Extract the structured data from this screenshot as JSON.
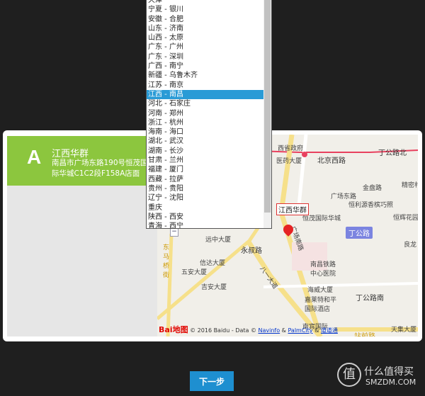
{
  "store": {
    "letter": "A",
    "name": "江西华群",
    "address": "南昌市广场东路190号恒茂国际华城C1C2段F158A店面"
  },
  "city_list": {
    "items": [
      "天津",
      "宁夏 - 银川",
      "安徽 - 合肥",
      "山东 - 济南",
      "山西 - 太原",
      "广东 - 广州",
      "广东 - 深圳",
      "广西 - 南宁",
      "新疆 - 乌鲁木齐",
      "江苏 - 南京",
      "江西 - 南昌",
      "河北 - 石家庄",
      "河南 - 郑州",
      "浙江 - 杭州",
      "海南 - 海口",
      "湖北 - 武汉",
      "湖南 - 长沙",
      "甘肃 - 兰州",
      "福建 - 厦门",
      "西藏 - 拉萨",
      "贵州 - 贵阳",
      "辽宁 - 沈阳",
      "重庆",
      "陕西 - 西安",
      "青海 - 西宁"
    ],
    "selected": "江西 - 南昌"
  },
  "map": {
    "marker_label": "江西华群",
    "labels": [
      "西省政府",
      "医药大厦",
      "北京西路",
      "丁公路北",
      "金盘路",
      "广场东路",
      "恒利源香槟巧照",
      "恒茂国际华城",
      "恒辉花园",
      "精密村",
      "远中大厦",
      "永叔路",
      "信达大厦",
      "五安大厦",
      "吉安大厦",
      "南昌铁路中心医院",
      "海威大厦",
      "嘉莱特和平国际酒店",
      "丁公路南",
      "南宾国际",
      "天集大厦",
      "站前路",
      "广场南路",
      "八一大道",
      "东马桥街",
      "良龙"
    ],
    "badge": "丁公路",
    "zoom_out": "−",
    "copyright": {
      "brand": "Bai地图",
      "text": "© 2016 Baidu - Data ©",
      "navinfo": "Navinfo",
      "amp1": "&",
      "palmcity": "PalmCity",
      "amp2": "&",
      "last": "道道通"
    }
  },
  "next_button": "下一步",
  "watermark": {
    "glyph": "值",
    "name": "什么值得买",
    "domain": "SMZDM.COM"
  }
}
